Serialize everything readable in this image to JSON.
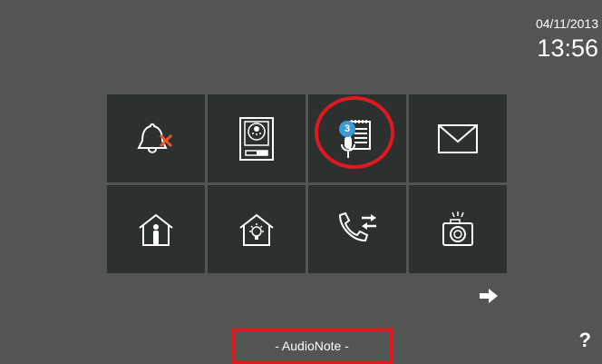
{
  "header": {
    "date": "04/11/2013",
    "time": "13:56"
  },
  "tiles": [
    {
      "icon": "bell-muted-icon"
    },
    {
      "icon": "door-panel-icon"
    },
    {
      "icon": "audio-note-icon",
      "badge": "3"
    },
    {
      "icon": "envelope-icon"
    },
    {
      "icon": "house-person-icon"
    },
    {
      "icon": "house-bulb-icon"
    },
    {
      "icon": "phone-transfer-icon"
    },
    {
      "icon": "camera-icon"
    }
  ],
  "footer": {
    "label": "- AudioNote -",
    "help": "?"
  },
  "colors": {
    "background": "#535555",
    "tile": "#2c302f",
    "highlight": "#e1181f",
    "badge": "#3a9ad9",
    "icon": "#ffffff"
  }
}
